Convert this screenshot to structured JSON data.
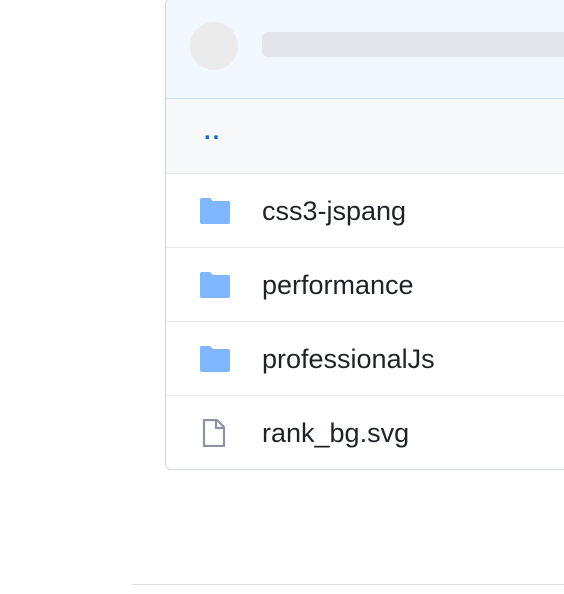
{
  "file_browser": {
    "parent_link": "..",
    "items": [
      {
        "name": "css3-jspang",
        "icon": "folder-icon"
      },
      {
        "name": "performance",
        "icon": "folder-icon"
      },
      {
        "name": "professionalJs",
        "icon": "folder-icon"
      },
      {
        "name": "rank_bg.svg",
        "icon": "file-icon"
      }
    ]
  },
  "colors": {
    "folder": "#80b5ff",
    "file": "#8c959f",
    "header_bg": "#f1f8ff",
    "link": "#0969da"
  }
}
